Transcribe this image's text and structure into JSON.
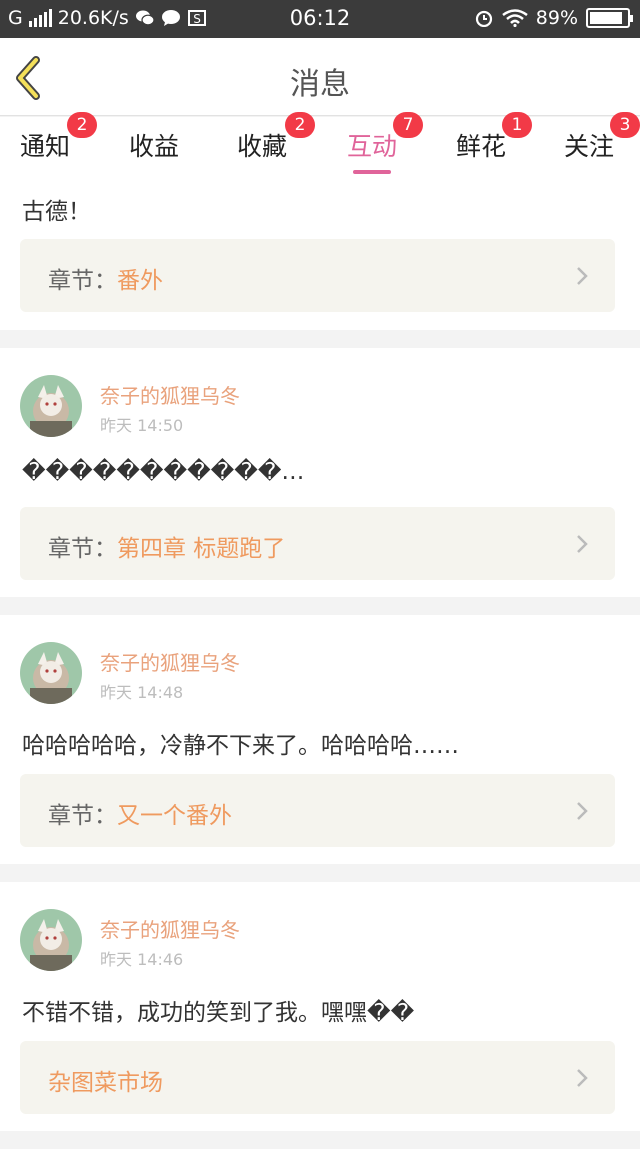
{
  "status_bar": {
    "network": "G",
    "speed": "20.6K/s",
    "time": "06:12",
    "battery": "89%",
    "battery_level": 0.89
  },
  "header": {
    "title": "消息"
  },
  "tabs": [
    {
      "label": "通知",
      "badge": "2"
    },
    {
      "label": "收益",
      "badge": ""
    },
    {
      "label": "收藏",
      "badge": "2"
    },
    {
      "label": "互动",
      "badge": "7",
      "active": true
    },
    {
      "label": "鲜花",
      "badge": "1"
    },
    {
      "label": "关注",
      "badge": "3"
    }
  ],
  "cards": [
    {
      "message": "古德！",
      "chapter_prefix": "章节：",
      "chapter": "番外"
    },
    {
      "user": "奈子的狐狸乌冬",
      "time": "昨天 14:50",
      "message": "�����������…",
      "chapter_prefix": "章节：",
      "chapter": "第四章 标题跑了"
    },
    {
      "user": "奈子的狐狸乌冬",
      "time": "昨天 14:48",
      "message": "哈哈哈哈哈，冷静不下来了。哈哈哈哈……",
      "chapter_prefix": "章节：",
      "chapter": "又一个番外"
    },
    {
      "user": "奈子的狐狸乌冬",
      "time": "昨天 14:46",
      "message": "不错不错，成功的笑到了我。嘿嘿��",
      "chapter_prefix": "",
      "chapter": "杂图菜市场"
    }
  ],
  "colors": {
    "accent_pink": "#e0649a",
    "username_orange": "#e9a27c",
    "chapter_orange": "#ef9a5f",
    "badge_red": "#f23a47",
    "back_arrow_yellow": "#f4e05a"
  }
}
